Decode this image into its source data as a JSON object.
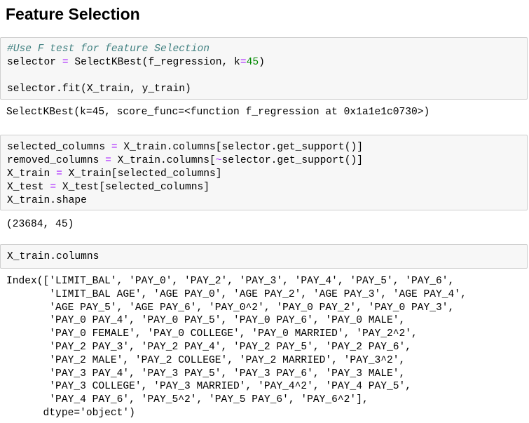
{
  "heading": "Feature Selection",
  "cells": [
    {
      "lines": [
        [
          {
            "t": "#Use F test for feature Selection",
            "c": "cm"
          }
        ],
        [
          {
            "t": "selector "
          },
          {
            "t": "=",
            "c": "op"
          },
          {
            "t": " SelectKBest(f_regression, k"
          },
          {
            "t": "=",
            "c": "op"
          },
          {
            "t": "45",
            "c": "num"
          },
          {
            "t": ")"
          }
        ],
        [
          {
            "t": ""
          }
        ],
        [
          {
            "t": "selector.fit(X_train, y_train)"
          }
        ]
      ],
      "output": "SelectKBest(k=45, score_func=<function f_regression at 0x1a1e1c0730>)"
    },
    {
      "lines": [
        [
          {
            "t": "selected_columns "
          },
          {
            "t": "=",
            "c": "op"
          },
          {
            "t": " X_train.columns[selector.get_support()]"
          }
        ],
        [
          {
            "t": "removed_columns "
          },
          {
            "t": "=",
            "c": "op"
          },
          {
            "t": " X_train.columns["
          },
          {
            "t": "~",
            "c": "op"
          },
          {
            "t": "selector.get_support()]"
          }
        ],
        [
          {
            "t": "X_train "
          },
          {
            "t": "=",
            "c": "op"
          },
          {
            "t": " X_train[selected_columns]"
          }
        ],
        [
          {
            "t": "X_test "
          },
          {
            "t": "=",
            "c": "op"
          },
          {
            "t": " X_test[selected_columns]"
          }
        ],
        [
          {
            "t": "X_train.shape"
          }
        ]
      ],
      "output": "(23684, 45)"
    },
    {
      "lines": [
        [
          {
            "t": "X_train.columns"
          }
        ]
      ],
      "output": "Index(['LIMIT_BAL', 'PAY_0', 'PAY_2', 'PAY_3', 'PAY_4', 'PAY_5', 'PAY_6',\n       'LIMIT_BAL AGE', 'AGE PAY_0', 'AGE PAY_2', 'AGE PAY_3', 'AGE PAY_4',\n       'AGE PAY_5', 'AGE PAY_6', 'PAY_0^2', 'PAY_0 PAY_2', 'PAY_0 PAY_3',\n       'PAY_0 PAY_4', 'PAY_0 PAY_5', 'PAY_0 PAY_6', 'PAY_0 MALE',\n       'PAY_0 FEMALE', 'PAY_0 COLLEGE', 'PAY_0 MARRIED', 'PAY_2^2',\n       'PAY_2 PAY_3', 'PAY_2 PAY_4', 'PAY_2 PAY_5', 'PAY_2 PAY_6',\n       'PAY_2 MALE', 'PAY_2 COLLEGE', 'PAY_2 MARRIED', 'PAY_3^2',\n       'PAY_3 PAY_4', 'PAY_3 PAY_5', 'PAY_3 PAY_6', 'PAY_3 MALE',\n       'PAY_3 COLLEGE', 'PAY_3 MARRIED', 'PAY_4^2', 'PAY_4 PAY_5',\n       'PAY_4 PAY_6', 'PAY_5^2', 'PAY_5 PAY_6', 'PAY_6^2'],\n      dtype='object')"
    }
  ]
}
